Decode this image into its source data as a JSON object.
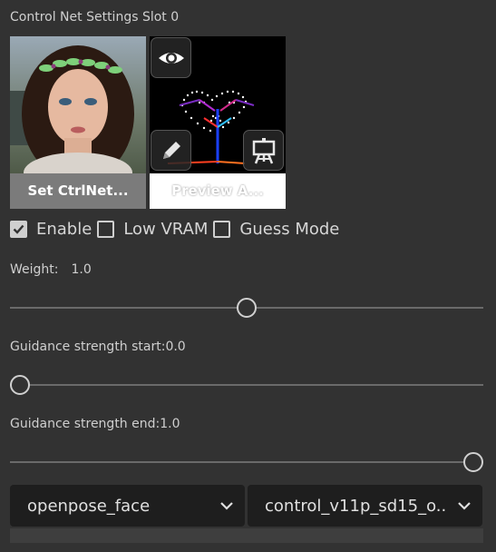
{
  "title": "Control Net Settings Slot 0",
  "thumbnails": [
    {
      "label": "Set CtrlNet..."
    },
    {
      "label": "Preview A..."
    }
  ],
  "icons": {
    "preview": "eye-icon",
    "edit": "pencil-icon",
    "easel": "easel-icon"
  },
  "checkboxes": [
    {
      "label": "Enable",
      "checked": true
    },
    {
      "label": "Low VRAM",
      "checked": false
    },
    {
      "label": "Guess Mode",
      "checked": false
    }
  ],
  "weight": {
    "label": "Weight:",
    "value": "1.0",
    "fraction": 0.5
  },
  "guidance_start": {
    "label": "Guidance strength start:0.0",
    "fraction": 0.0
  },
  "guidance_end": {
    "label": "Guidance strength end:1.0",
    "fraction": 1.0
  },
  "selects": {
    "preprocessor": "openpose_face",
    "model": "control_v11p_sd15_o..."
  },
  "colors": {
    "background": "#323232",
    "select_bg": "#1e1e1e",
    "text": "#cfcfcf"
  }
}
